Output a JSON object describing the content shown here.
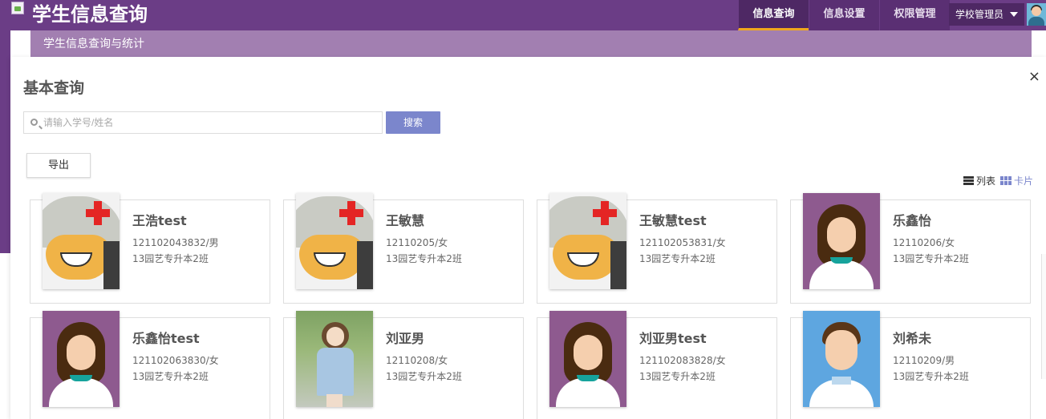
{
  "header": {
    "app_title": "学生信息查询",
    "nav": [
      {
        "label": "信息查询",
        "active": true
      },
      {
        "label": "信息设置",
        "active": false
      },
      {
        "label": "权限管理",
        "active": false
      }
    ],
    "user_label": "学校管理员",
    "subtitle": "学生信息查询与统计"
  },
  "panel": {
    "title": "基本查询",
    "close_symbol": "×",
    "search": {
      "placeholder": "请输入学号/姓名",
      "value": ""
    },
    "search_button": "搜索",
    "export_button": "导出",
    "view": {
      "list_label": "列表",
      "card_label": "卡片",
      "selected": "card"
    }
  },
  "students": [
    {
      "name": "王浩test",
      "id_gender": "121102043832/男",
      "class": "13园艺专升本2班",
      "photo": "soldier"
    },
    {
      "name": "王敏慧",
      "id_gender": "12110205/女",
      "class": "13园艺专升本2班",
      "photo": "soldier"
    },
    {
      "name": "王敏慧test",
      "id_gender": "121102053831/女",
      "class": "13园艺专升本2班",
      "photo": "soldier"
    },
    {
      "name": "乐鑫怡",
      "id_gender": "12110206/女",
      "class": "13园艺专升本2班",
      "photo": "girl"
    },
    {
      "name": "乐鑫怡test",
      "id_gender": "121102063830/女",
      "class": "13园艺专升本2班",
      "photo": "girl"
    },
    {
      "name": "刘亚男",
      "id_gender": "12110208/女",
      "class": "13园艺专升本2班",
      "photo": "real"
    },
    {
      "name": "刘亚男test",
      "id_gender": "121102083828/女",
      "class": "13园艺专升本2班",
      "photo": "girl"
    },
    {
      "name": "刘希未",
      "id_gender": "12110209/男",
      "class": "13园艺专升本2班",
      "photo": "boy"
    }
  ],
  "colors": {
    "header": "#6b3d86",
    "subbar": "#a27fb1",
    "accent": "#7b86cc",
    "active_underline": "#f0a81d"
  }
}
